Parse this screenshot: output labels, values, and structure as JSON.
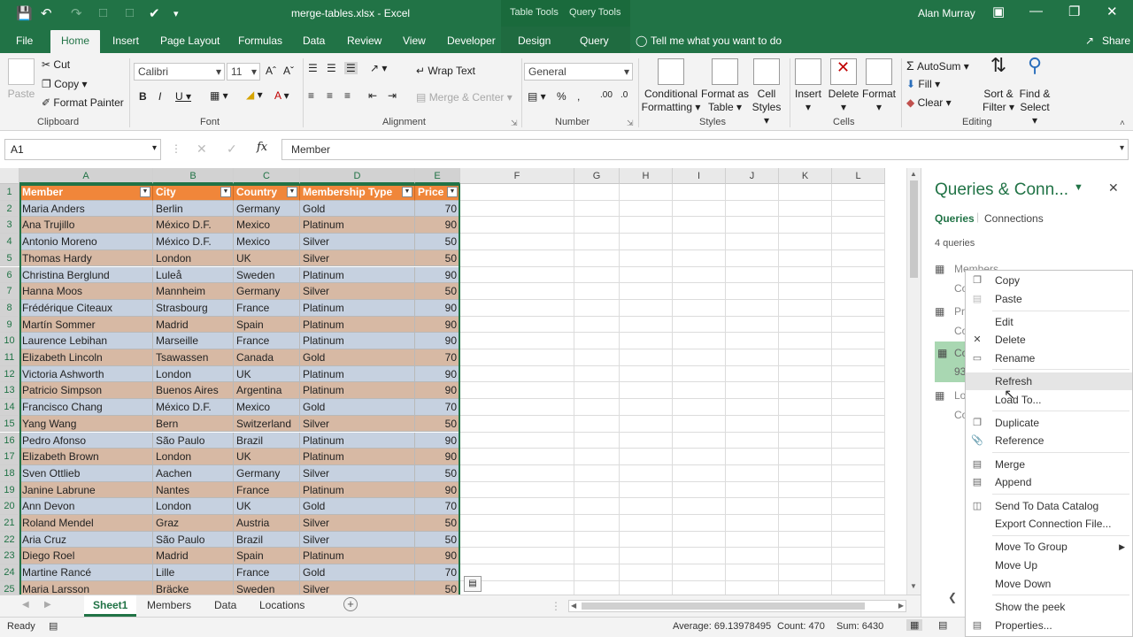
{
  "titlebar": {
    "title": "merge-tables.xlsx  -  Excel",
    "context_tab1": "Table Tools",
    "context_tab2": "Query Tools",
    "user": "Alan Murray"
  },
  "ribbon_tabs": [
    "File",
    "Home",
    "Insert",
    "Page Layout",
    "Formulas",
    "Data",
    "Review",
    "View",
    "Developer",
    "Design",
    "Query"
  ],
  "tell_me": "Tell me what you want to do",
  "share": "Share",
  "ribbon": {
    "clipboard": {
      "paste": "Paste",
      "cut": "Cut",
      "copy": "Copy",
      "format_painter": "Format Painter",
      "label": "Clipboard"
    },
    "font": {
      "name": "Calibri",
      "size": "11",
      "label": "Font"
    },
    "alignment": {
      "wrap": "Wrap Text",
      "merge": "Merge & Center",
      "label": "Alignment"
    },
    "number": {
      "format": "General",
      "label": "Number"
    },
    "styles": {
      "conditional": "Conditional",
      "conditional2": "Formatting",
      "format_as": "Format as",
      "format_as2": "Table",
      "cell": "Cell",
      "cell2": "Styles",
      "label": "Styles"
    },
    "cells": {
      "insert": "Insert",
      "delete": "Delete",
      "format": "Format",
      "label": "Cells"
    },
    "editing": {
      "autosum": "AutoSum",
      "fill": "Fill",
      "clear": "Clear",
      "sort": "Sort &",
      "sort2": "Filter",
      "find": "Find &",
      "find2": "Select",
      "label": "Editing"
    }
  },
  "formula_bar": {
    "name_box": "A1",
    "value": "Member"
  },
  "columns": [
    "A",
    "B",
    "C",
    "D",
    "E",
    "F",
    "G",
    "H",
    "I",
    "J",
    "K",
    "L"
  ],
  "table": {
    "headers": [
      "Member",
      "City",
      "Country",
      "Membership Type",
      "Price"
    ],
    "rows": [
      [
        "Maria Anders",
        "Berlin",
        "Germany",
        "Gold",
        "70"
      ],
      [
        "Ana Trujillo",
        "México D.F.",
        "Mexico",
        "Platinum",
        "90"
      ],
      [
        "Antonio Moreno",
        "México D.F.",
        "Mexico",
        "Silver",
        "50"
      ],
      [
        "Thomas Hardy",
        "London",
        "UK",
        "Silver",
        "50"
      ],
      [
        "Christina Berglund",
        "Luleå",
        "Sweden",
        "Platinum",
        "90"
      ],
      [
        "Hanna Moos",
        "Mannheim",
        "Germany",
        "Silver",
        "50"
      ],
      [
        "Frédérique Citeaux",
        "Strasbourg",
        "France",
        "Platinum",
        "90"
      ],
      [
        "Martín Sommer",
        "Madrid",
        "Spain",
        "Platinum",
        "90"
      ],
      [
        "Laurence Lebihan",
        "Marseille",
        "France",
        "Platinum",
        "90"
      ],
      [
        "Elizabeth Lincoln",
        "Tsawassen",
        "Canada",
        "Gold",
        "70"
      ],
      [
        "Victoria Ashworth",
        "London",
        "UK",
        "Platinum",
        "90"
      ],
      [
        "Patricio Simpson",
        "Buenos Aires",
        "Argentina",
        "Platinum",
        "90"
      ],
      [
        "Francisco Chang",
        "México D.F.",
        "Mexico",
        "Gold",
        "70"
      ],
      [
        "Yang Wang",
        "Bern",
        "Switzerland",
        "Silver",
        "50"
      ],
      [
        "Pedro Afonso",
        "São Paulo",
        "Brazil",
        "Platinum",
        "90"
      ],
      [
        "Elizabeth Brown",
        "London",
        "UK",
        "Platinum",
        "90"
      ],
      [
        "Sven Ottlieb",
        "Aachen",
        "Germany",
        "Silver",
        "50"
      ],
      [
        "Janine Labrune",
        "Nantes",
        "France",
        "Platinum",
        "90"
      ],
      [
        "Ann Devon",
        "London",
        "UK",
        "Gold",
        "70"
      ],
      [
        "Roland Mendel",
        "Graz",
        "Austria",
        "Silver",
        "50"
      ],
      [
        "Aria Cruz",
        "São Paulo",
        "Brazil",
        "Silver",
        "50"
      ],
      [
        "Diego Roel",
        "Madrid",
        "Spain",
        "Platinum",
        "90"
      ],
      [
        "Martine Rancé",
        "Lille",
        "France",
        "Gold",
        "70"
      ],
      [
        "Maria Larsson",
        "Bräcke",
        "Sweden",
        "Silver",
        "50"
      ]
    ]
  },
  "sheets": [
    "Sheet1",
    "Members",
    "Data",
    "Locations"
  ],
  "status": {
    "ready": "Ready",
    "average": "Average: 69.13978495",
    "count": "Count: 470",
    "sum": "Sum: 6430"
  },
  "pane": {
    "title": "Queries & Conn...",
    "tab_queries": "Queries",
    "tab_connections": "Connections",
    "count": "4 queries",
    "items": [
      {
        "name": "Members",
        "sub": "Co"
      },
      {
        "name": "Pr",
        "sub": "Co"
      },
      {
        "name": "Co",
        "sub": "93"
      },
      {
        "name": "Lo",
        "sub": "Co"
      }
    ]
  },
  "context_menu": [
    "Copy",
    "Paste",
    "Edit",
    "Delete",
    "Rename",
    "Refresh",
    "Load To...",
    "Duplicate",
    "Reference",
    "Merge",
    "Append",
    "Send To Data Catalog",
    "Export Connection File...",
    "Move To Group",
    "Move Up",
    "Move Down",
    "Show the peek",
    "Properties..."
  ],
  "colors": {
    "excel_green": "#217346",
    "header_orange": "#f0863a",
    "row_blue": "#c6d1e0",
    "row_tan": "#d7b9a4",
    "query_selected": "#a9d7b2"
  }
}
